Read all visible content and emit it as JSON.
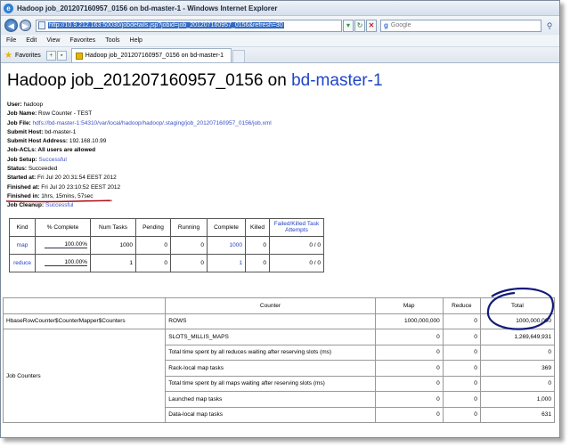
{
  "window": {
    "title": "Hadoop job_201207160957_0156 on bd-master-1 - Windows Internet Explorer"
  },
  "addressbar": {
    "url": "http://10.9.212.163:50030/jobdetails.jsp?jobid=job_201207160957_0156&refresh=30",
    "search_placeholder": "Google"
  },
  "menu": [
    "File",
    "Edit",
    "View",
    "Favorites",
    "Tools",
    "Help"
  ],
  "favorites_label": "Favorites",
  "tab_title": "Hadoop job_201207160957_0156 on bd-master-1",
  "page": {
    "title_prefix": "Hadoop job_201207160957_0156 on ",
    "title_host": "bd-master-1",
    "info": {
      "user_label": "User:",
      "user": "hadoop",
      "jobname_label": "Job Name:",
      "jobname": "Row Counter - TEST",
      "jobfile_label": "Job File:",
      "jobfile": "hdfs://bd-master-1:54310/var/local/hadoop/hadoop/.staging/job_201207160957_0156/job.xml",
      "submithost_label": "Submit Host:",
      "submithost": "bd-master-1",
      "submitaddr_label": "Submit Host Address:",
      "submitaddr": "192.168.10.99",
      "acls_label": "Job-ACLs: All users are allowed",
      "setup_label": "Job Setup:",
      "setup": "Successful",
      "status_label": "Status:",
      "status": "Succeeded",
      "started_label": "Started at:",
      "started": "Fri Jul 20 20:31:54 EEST 2012",
      "finished_label": "Finished at:",
      "finished": "Fri Jul 20 23:10:52 EEST 2012",
      "finishedin_label": "Finished in:",
      "finishedin": "1hrs, 15mins, 57sec",
      "cleanup_label": "Job Cleanup:",
      "cleanup": "Successful"
    },
    "tasks": {
      "headers": [
        "Kind",
        "% Complete",
        "Num Tasks",
        "Pending",
        "Running",
        "Complete",
        "Killed",
        "Failed/Killed Task Attempts"
      ],
      "rows": [
        {
          "kind": "map",
          "pct": "100.00%",
          "num": "1000",
          "pending": "0",
          "running": "0",
          "complete": "1000",
          "killed": "0",
          "attempts": "0 / 0"
        },
        {
          "kind": "reduce",
          "pct": "100.00%",
          "num": "1",
          "pending": "0",
          "running": "0",
          "complete": "1",
          "killed": "0",
          "attempts": "0 / 0"
        }
      ]
    },
    "counters": {
      "headers": [
        "Counter",
        "Map",
        "Reduce",
        "Total"
      ],
      "hbase_group": "HbaseRowCounter$CounterMapper$Counters",
      "hbase_row": {
        "name": "ROWS",
        "map": "1000,000,000",
        "reduce": "0",
        "total": "1000,000,000"
      },
      "job_group": "Job Counters",
      "job_rows": [
        {
          "name": "SLOTS_MILLIS_MAPS",
          "map": "0",
          "reduce": "0",
          "total": "1,269,649,931"
        },
        {
          "name": "Total time spent by all reduces waiting after reserving slots (ms)",
          "map": "0",
          "reduce": "0",
          "total": "0"
        },
        {
          "name": "Rack-local map tasks",
          "map": "0",
          "reduce": "0",
          "total": "369"
        },
        {
          "name": "Total time spent by all maps waiting after reserving slots (ms)",
          "map": "0",
          "reduce": "0",
          "total": "0"
        },
        {
          "name": "Launched map tasks",
          "map": "0",
          "reduce": "0",
          "total": "1,000"
        },
        {
          "name": "Data-local map tasks",
          "map": "0",
          "reduce": "0",
          "total": "631"
        }
      ]
    }
  },
  "colors": {
    "link": "#1f46c8",
    "annotation": "#b0101a",
    "circle": "#141a7a"
  },
  "icons": [
    "ie-logo-icon",
    "back-arrow-icon",
    "forward-arrow-icon",
    "page-icon",
    "go-icon",
    "refresh-icon",
    "stop-icon",
    "search-icon",
    "favorites-star-icon",
    "tab-page-icon"
  ]
}
